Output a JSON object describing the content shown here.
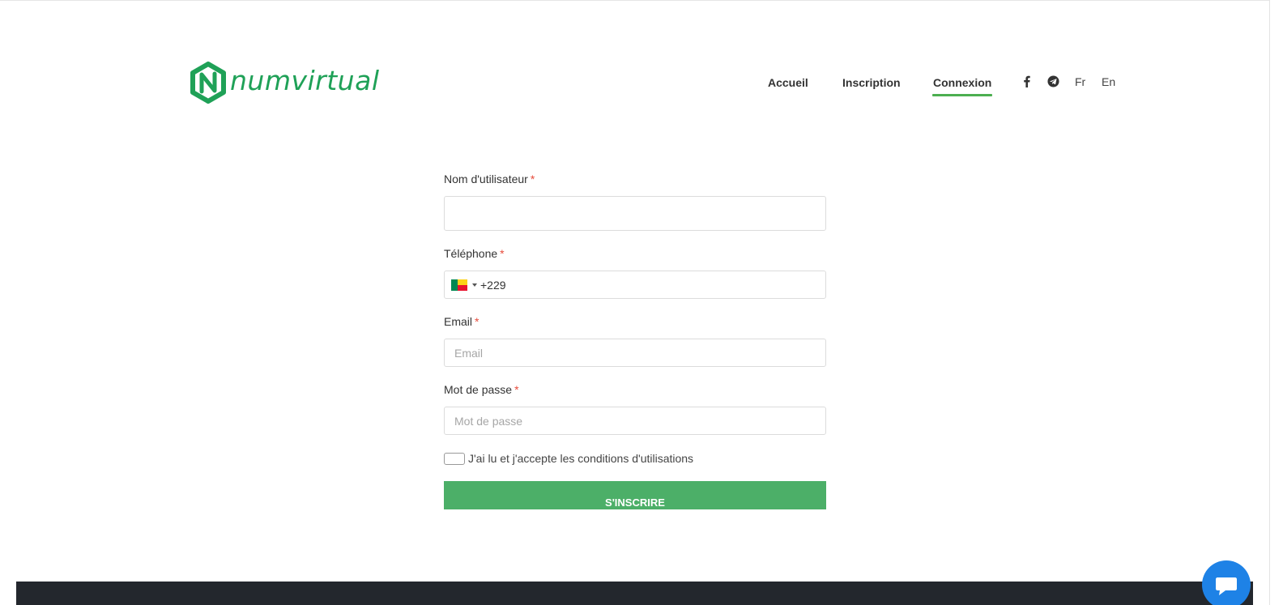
{
  "brand": {
    "name": "numvirtual",
    "color": "#1fa157"
  },
  "nav": {
    "home": "Accueil",
    "signup": "Inscription",
    "login": "Connexion",
    "active": "login"
  },
  "social": {
    "facebook_icon": "facebook-icon",
    "telegram_icon": "telegram-icon"
  },
  "languages": {
    "fr": "Fr",
    "en": "En"
  },
  "form": {
    "username": {
      "label": "Nom d'utilisateur",
      "required": "*",
      "value": "",
      "placeholder": ""
    },
    "phone": {
      "label": "Téléphone",
      "required": "*",
      "country": "Benin",
      "dial_code": "+229"
    },
    "email": {
      "label": "Email",
      "required": "*",
      "value": "",
      "placeholder": "Email"
    },
    "password": {
      "label": "Mot de passe",
      "required": "*",
      "value": "",
      "placeholder": "Mot de passe"
    },
    "terms_label": "J'ai lu et j'accepte les conditions d'utilisations",
    "terms_checked": false,
    "submit_label": "S'INSCRIRE"
  },
  "colors": {
    "accent_green": "#4caf68",
    "footer": "#23272d",
    "chat_button": "#1e82e6",
    "required": "#e74c3c"
  },
  "chat": {
    "icon": "chat-bubble-icon"
  }
}
